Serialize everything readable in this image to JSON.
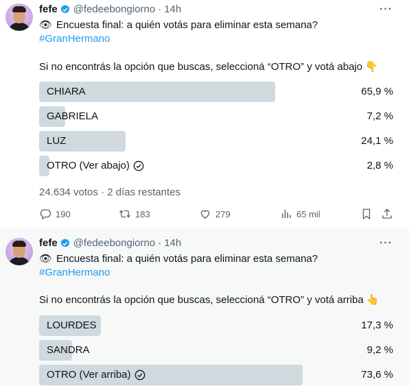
{
  "tweets": [
    {
      "author": {
        "name": "fefe",
        "handle": "@fedeebongiorno",
        "separator": "·",
        "time": "14h"
      },
      "eye_emoji": "👁",
      "text": "Encuesta final: a quién votás para eliminar esta semana?",
      "hashtag": "#GranHermano",
      "instruction": "Si no encontrás la opción que buscas, seleccioná “OTRO” y votá abajo",
      "instruction_emoji": "👇",
      "poll": [
        {
          "label": "CHIARA",
          "percent": "65,9 %",
          "fraction": 0.659,
          "has_check": false
        },
        {
          "label": "GABRIELA",
          "percent": "7,2 %",
          "fraction": 0.072,
          "has_check": false
        },
        {
          "label": "LUZ",
          "percent": "24,1 %",
          "fraction": 0.241,
          "has_check": false
        },
        {
          "label": "OTRO (Ver abajo)",
          "percent": "2,8 %",
          "fraction": 0.028,
          "has_check": true
        }
      ],
      "poll_meta": "24.634 votos · 2 días restantes",
      "actions": {
        "replies": "190",
        "retweets": "183",
        "likes": "279",
        "views": "65 mil"
      }
    },
    {
      "author": {
        "name": "fefe",
        "handle": "@fedeebongiorno",
        "separator": "·",
        "time": "14h"
      },
      "eye_emoji": "👁",
      "text": "Encuesta final: a quién votás para eliminar esta semana?",
      "hashtag": "#GranHermano",
      "instruction": "Si no encontrás la opción que buscas, seleccioná “OTRO” y votá arriba",
      "instruction_emoji": "👆",
      "poll": [
        {
          "label": "LOURDES",
          "percent": "17,3 %",
          "fraction": 0.173,
          "has_check": false
        },
        {
          "label": "SANDRA",
          "percent": "9,2 %",
          "fraction": 0.092,
          "has_check": false
        },
        {
          "label": "OTRO (Ver arriba)",
          "percent": "73,6 %",
          "fraction": 0.736,
          "has_check": true
        }
      ]
    }
  ],
  "colors": {
    "accent": "#1d9bf0",
    "bar": "#cfd9de",
    "muted": "#536471",
    "text": "#0f1419"
  }
}
